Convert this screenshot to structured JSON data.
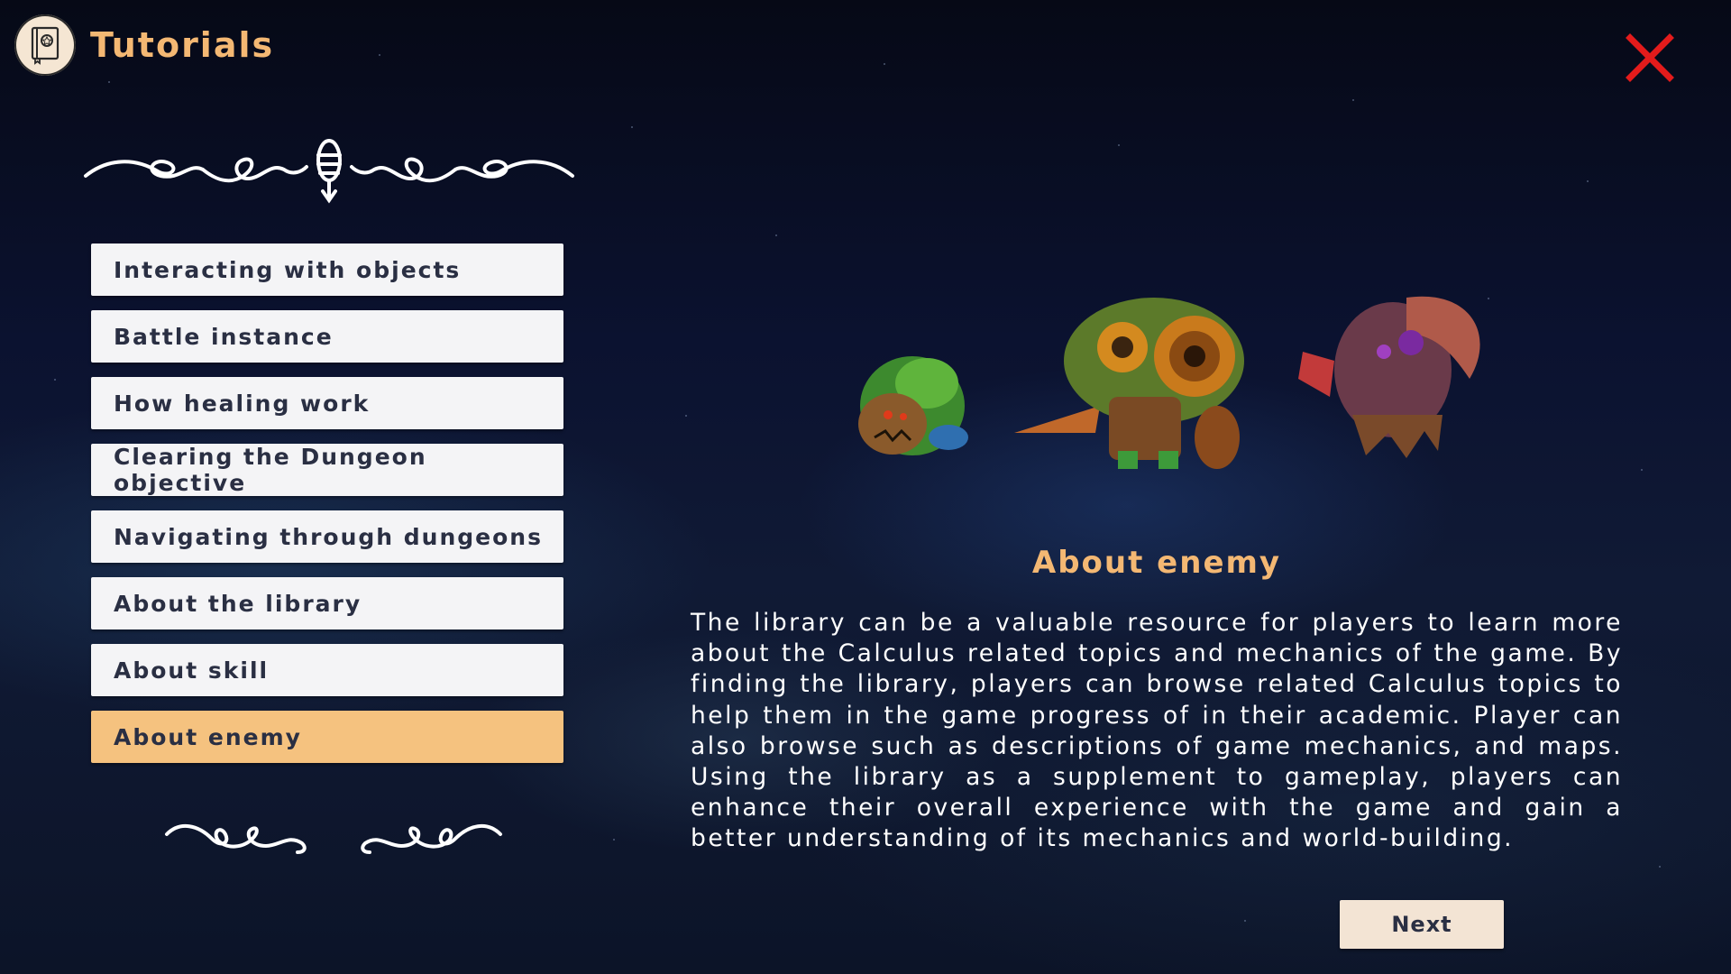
{
  "header": {
    "title": "Tutorials",
    "icon": "tutorial-book-icon"
  },
  "close": {
    "icon": "close-icon",
    "color": "#e31b1b"
  },
  "menu": {
    "items": [
      {
        "label": "Interacting with objects",
        "active": false
      },
      {
        "label": "Battle instance",
        "active": false
      },
      {
        "label": "How healing work",
        "active": false
      },
      {
        "label": "Clearing the Dungeon objective",
        "active": false
      },
      {
        "label": "Navigating through dungeons",
        "active": false
      },
      {
        "label": "About the library",
        "active": false
      },
      {
        "label": "About skill",
        "active": false
      },
      {
        "label": "About enemy",
        "active": true
      }
    ]
  },
  "content": {
    "title": "About enemy",
    "body": "The library can be a valuable resource for players to learn more about the Calculus related topics and mechanics of the game. By finding the library, players can browse related Calculus topics to help them in the game progress of in their academic. Player can also browse such as descriptions of game mechanics, and maps. Using the library as a supplement to gameplay, players can enhance their overall experience with the game and gain a better understanding of its mechanics and world-building.",
    "enemies": [
      "bush-creature",
      "owl-tree-creature",
      "horned-tree-creature"
    ]
  },
  "footer": {
    "next_label": "Next"
  },
  "colors": {
    "accent": "#f4b873",
    "active_item": "#f5c27f",
    "item_bg": "#f4f4f6",
    "text_dark": "#2a2f43"
  }
}
